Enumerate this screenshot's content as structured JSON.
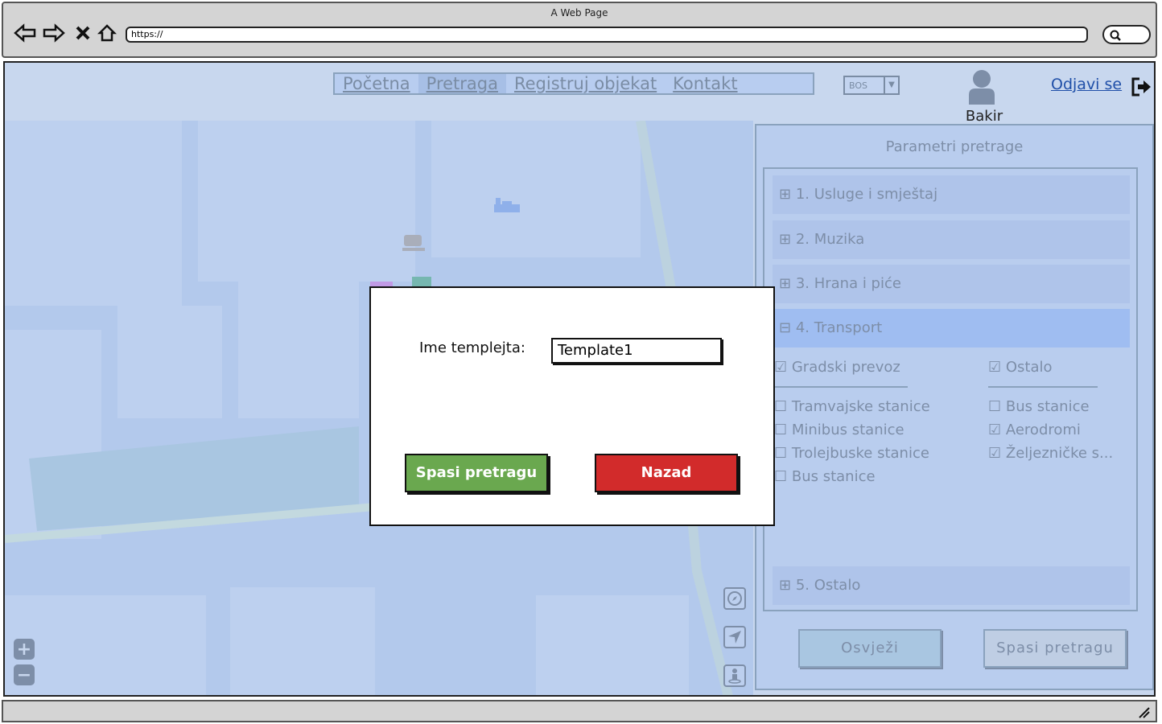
{
  "browser": {
    "title": "A Web Page",
    "url": "https://"
  },
  "nav": {
    "items": [
      "Početna",
      "Pretraga",
      "Registruj objekat",
      "Kontakt"
    ],
    "selected_index": 1
  },
  "language": {
    "value": "BOS"
  },
  "user": {
    "name": "Bakir"
  },
  "logout": {
    "label": "Odjavi se"
  },
  "panel": {
    "title": "Parametri pretrage",
    "accordion": [
      {
        "label": "1. Usluge i smještaj",
        "expanded": false
      },
      {
        "label": "2. Muzika",
        "expanded": false
      },
      {
        "label": "3. Hrana i piće",
        "expanded": false
      },
      {
        "label": "4. Transport",
        "expanded": true
      },
      {
        "label": "5. Ostalo",
        "expanded": false
      }
    ],
    "transport": {
      "group_left": {
        "label": "Gradski prevoz",
        "checked": true
      },
      "group_right": {
        "label": "Ostalo",
        "checked": true
      },
      "left_items": [
        {
          "label": "Tramvajske stanice",
          "checked": false
        },
        {
          "label": "Minibus stanice",
          "checked": false
        },
        {
          "label": "Trolejbuske stanice",
          "checked": false
        },
        {
          "label": "Bus stanice",
          "checked": false
        }
      ],
      "right_items": [
        {
          "label": "Bus stanice",
          "checked": false
        },
        {
          "label": "Aerodromi",
          "checked": true
        },
        {
          "label": "Željezničke s...",
          "checked": true
        }
      ]
    },
    "refresh_label": "Osvježi",
    "save_label": "Spasi pretragu"
  },
  "modal": {
    "label": "Ime templejta:",
    "input_value": "Template1",
    "save_label": "Spasi pretragu",
    "back_label": "Nazad",
    "save_color": "#6aa84f",
    "back_color": "#d22b2b"
  },
  "colors": {
    "overlay": "#c8d7ee",
    "map_water": "#a9c6e1"
  }
}
